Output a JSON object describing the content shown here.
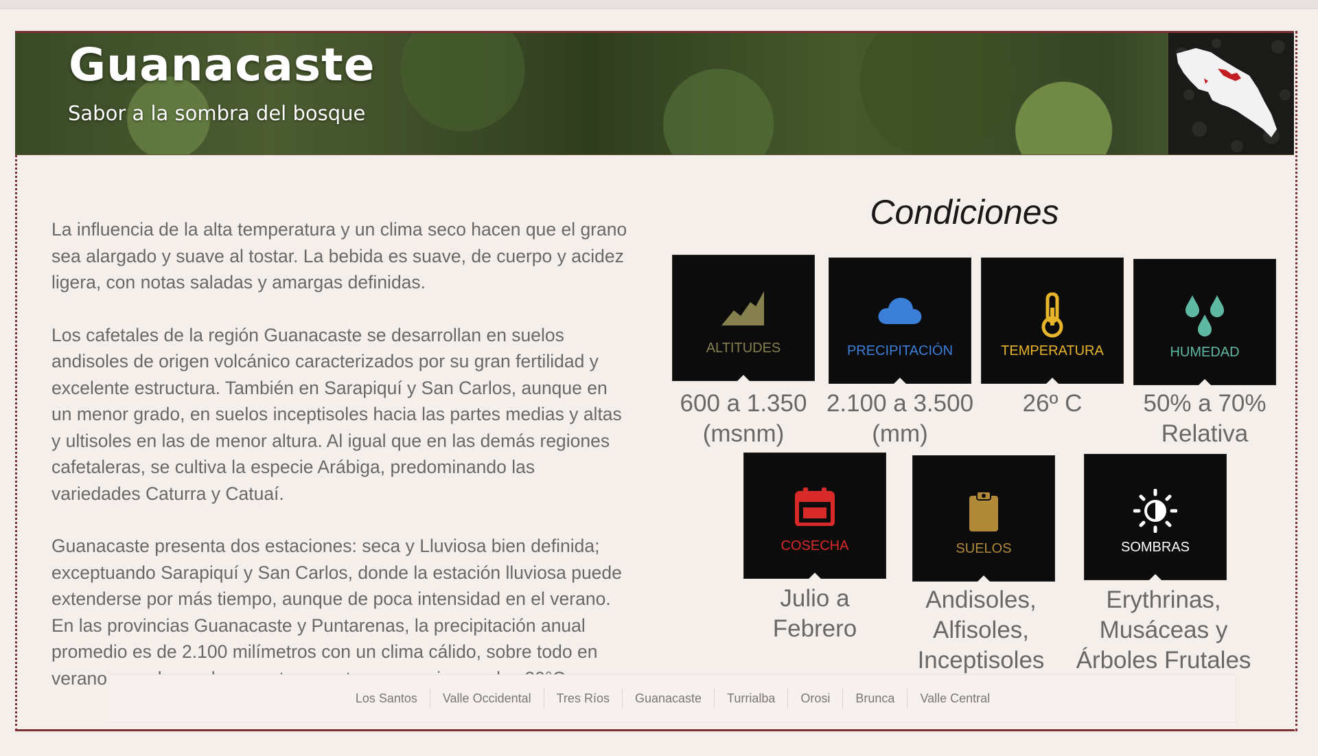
{
  "header": {
    "title": "Guanacaste",
    "subtitle": "Sabor a la sombra del bosque",
    "map_icon": "costa-rica-map-icon"
  },
  "description": {
    "paragraphs": [
      "La influencia de la alta temperatura y un clima seco hacen que el grano sea alargado y suave al tostar. La bebida es suave, de cuerpo y acidez ligera, con notas saladas y amargas definidas.",
      "Los cafetales de la región Guanacaste se desarrollan en suelos andisoles de origen volcánico caracterizados por su gran fertilidad y excelente estructura. También en Sarapiquí y San Carlos, aunque en un menor grado, en suelos inceptisoles hacia las partes medias y altas y ultisoles en las de menor altura. Al igual que en las demás regiones cafetaleras, se cultiva la especie Arábiga, predominando las variedades Caturra y Catuaí.",
      "Guanacaste presenta dos estaciones: seca y Lluviosa bien definida; exceptuando Sarapiquí y San Carlos, donde la estación lluviosa puede extenderse por más tiempo, aunque de poca intensidad en el verano. En las provincias Guanacaste y Puntarenas, la precipitación anual promedio es de 2.100 milímetros con un clima cálido, sobre todo en verano cuando se alcanzan temperaturas superiores a los 30°C"
    ]
  },
  "conditions": {
    "title": "Condiciones",
    "altitudes": {
      "label": "ALTITUDES",
      "value_line1": "600 a 1.350",
      "value_line2": "(msnm)",
      "icon": "mountain-chart-icon",
      "color": "#86804f"
    },
    "precipitacion": {
      "label": "PRECIPITACIÓN",
      "value_line1": "2.100 a 3.500",
      "value_line2": "(mm)",
      "icon": "cloud-icon",
      "color": "#3b7fd8"
    },
    "temperatura": {
      "label": "TEMPERATURA",
      "value_line1": "26º C",
      "value_line2": "",
      "icon": "thermometer-icon",
      "color": "#e7b52c"
    },
    "humedad": {
      "label": "HUMEDAD",
      "value_line1": "50% a 70%",
      "value_line2": "Relativa",
      "icon": "water-drops-icon",
      "color": "#5fb8a2"
    },
    "cosecha": {
      "label": "COSECHA",
      "value_line1": "Julio a",
      "value_line2": "Febrero",
      "icon": "calendar-icon",
      "color": "#d92a2a"
    },
    "suelos": {
      "label": "SUELOS",
      "value_line1": "Andisoles,",
      "value_line2": "Alfisoles,",
      "value_line3": "Inceptisoles",
      "icon": "clipboard-icon",
      "color": "#b08a39"
    },
    "sombras": {
      "label": "SOMBRAS",
      "value_line1": "Erythrinas, Musáceas y",
      "value_line2": "Árboles Frutales",
      "icon": "brightness-icon",
      "color": "#ffffff"
    }
  },
  "footer_nav": [
    "Los Santos",
    "Valle Occidental",
    "Tres Ríos",
    "Guanacaste",
    "Turrialba",
    "Orosi",
    "Brunca",
    "Valle Central"
  ]
}
